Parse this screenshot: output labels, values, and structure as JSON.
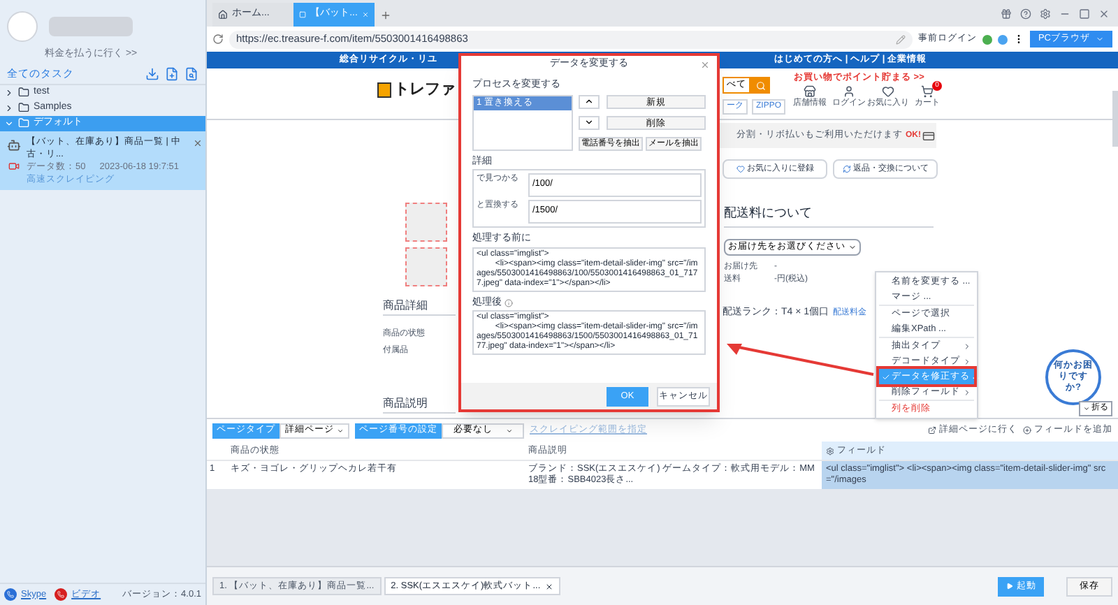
{
  "sidebar": {
    "pay_link": "料金を払うに行く >>",
    "all_tasks": "全てのタスク",
    "folders": [
      {
        "name": "test",
        "expanded": false,
        "selected": false
      },
      {
        "name": "Samples",
        "expanded": false,
        "selected": false
      },
      {
        "name": "デフォルト",
        "expanded": true,
        "selected": true,
        "children": [
          {
            "title": "【バット、在庫あり】商品一覧 | 中古・リ...",
            "count": "データ数：50",
            "time": "2023-06-18 19:7:51",
            "mode": "高速スクレイピング"
          }
        ]
      }
    ],
    "footer_links": [
      "Skype",
      "ビデオ"
    ],
    "version": "バージョン：4.0.1"
  },
  "browser": {
    "tabs": [
      {
        "label": "ホーム...",
        "selected": false
      },
      {
        "label": "【バット...",
        "selected": true
      }
    ],
    "url": "https://ec.treasure-f.com/item/5503001416498863",
    "login": "事前ログイン",
    "browser_button": "PCブラウザ"
  },
  "page": {
    "banner_left": "総合リサイクル・リユ",
    "banner_right": "はじめての方へ | ヘルプ | 企業情報",
    "logo": "トレファ",
    "search_scope": "べて",
    "tags": [
      "ーク",
      "ZIPPO"
    ],
    "promo": "お買い物でポイント貯まる >>",
    "nav": [
      "店舗情報",
      "ログイン",
      "お気に入り",
      "カート"
    ],
    "cart_count": "0",
    "payment": "分割・リボ払いもご利用いただけます",
    "ok_badge": "OK!",
    "buttons": [
      "お気に入りに登録",
      "返品・交換について"
    ],
    "shipping_title": "配送料について",
    "destination": "お届け先をお選びください",
    "info": [
      {
        "label": "お届け先",
        "value": "-"
      },
      {
        "label": "送料",
        "value": "-円(税込)"
      }
    ],
    "rank": "配送ランク：T4 × 1個口",
    "rank_link": "配送料金",
    "sections": [
      {
        "title": "商品詳細",
        "fields": [
          "商品の状態",
          "付属品"
        ]
      },
      {
        "title": "商品説明"
      }
    ]
  },
  "dialog": {
    "title": "データを変更する",
    "process_label": "プロセスを変更する",
    "processes": [
      {
        "label": "1 置き換える",
        "selected": true
      }
    ],
    "buttons": [
      "新規",
      "削除"
    ],
    "extract_buttons": [
      "電話番号を抽出",
      "メールを抽出"
    ],
    "detail_label": "詳細",
    "fields": [
      {
        "label": "で見つかる",
        "value": "/100/"
      },
      {
        "label": "と置換する",
        "value": "/1500/"
      }
    ],
    "before_label": "処理する前に",
    "before": "<ul class=\"imglist\">\n        <li><span><img class=\"item-detail-slider-img\" src=\"/images/5503001416498863/100/5503001416498863_01_7177.jpeg\" data-index=\"1\"></span></li>",
    "after_label": "処理後",
    "after": "<ul class=\"imglist\">\n        <li><span><img class=\"item-detail-slider-img\" src=\"/images/5503001416498863/1500/5503001416498863_01_7177.jpeg\" data-index=\"1\"></span></li>",
    "ok": "OK",
    "cancel": "キャンセル"
  },
  "panel": {
    "page_type_label": "ページタイプ",
    "page_type": "詳細ページ",
    "page_number_label": "ページ番号の設定",
    "page_number": "必要なし",
    "range_button": "スクレイピング範囲を指定",
    "actions": [
      "詳細ページに行く",
      "フィールドを追加"
    ],
    "columns": [
      {
        "label": "商品の状態",
        "selected": false
      },
      {
        "label": "商品説明",
        "selected": false
      },
      {
        "label": "フィールド",
        "selected": true
      }
    ],
    "rows": [
      {
        "index": "1",
        "cells": [
          "キズ・ヨゴレ・グリップヘカレ若干有",
          "ブランド：SSK(エスエスケイ) ゲームタイプ：軟式用モデル：MM18型番：SBB4023長さ...",
          "<ul class=\"imglist\"> <li><span><img class=\"item-detail-slider-img\" src=\"/images"
        ]
      }
    ]
  },
  "menu": {
    "groups": [
      [
        {
          "label": "名前を変更する ...",
          "kind": "normal",
          "checked": false,
          "selected": false
        },
        {
          "label": "マージ ...",
          "kind": "normal",
          "checked": false,
          "selected": false
        }
      ],
      [
        {
          "label": "ページで選択",
          "kind": "normal",
          "checked": false,
          "selected": false
        },
        {
          "label": "編集XPath ...",
          "kind": "normal",
          "checked": false,
          "selected": false
        }
      ],
      [
        {
          "label": "抽出タイプ",
          "kind": "submenu",
          "checked": false,
          "selected": false
        },
        {
          "label": "デコードタイプ",
          "kind": "submenu",
          "checked": false,
          "selected": false
        },
        {
          "label": "データを修正する ...",
          "kind": "normal",
          "checked": true,
          "selected": true
        },
        {
          "label": "削除フィールド",
          "kind": "submenu",
          "checked": false,
          "selected": false
        }
      ],
      [
        {
          "label": "列を削除",
          "kind": "danger",
          "checked": false,
          "selected": false
        }
      ]
    ]
  },
  "help": {
    "text": "何かお困りですか?",
    "fold": "折る"
  },
  "bottom": {
    "tabs": [
      {
        "label": "1. 【バット、在庫あり】商品一覧...",
        "selected": false
      },
      {
        "label": "2. SSK(エスエスケイ)軟式バット...",
        "selected": true
      }
    ],
    "start": "起動",
    "save": "保存"
  }
}
